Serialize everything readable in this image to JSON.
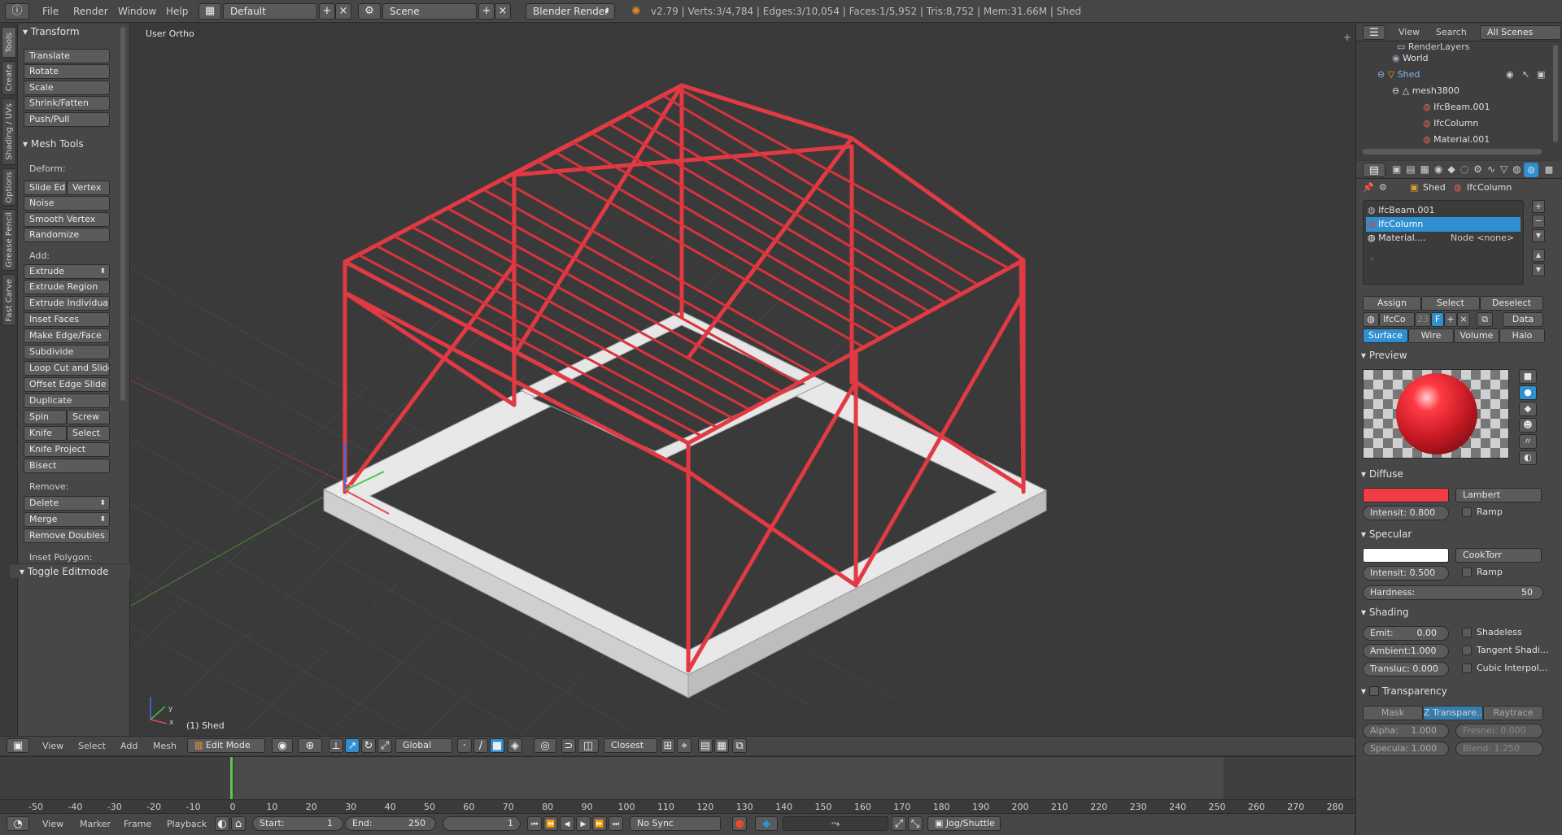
{
  "topbar": {
    "menus": [
      "File",
      "Render",
      "Window",
      "Help"
    ],
    "layout": "Default",
    "scene": "Scene",
    "engine": "Blender Render",
    "stats": "v2.79 | Verts:3/4,784 | Edges:3/10,054 | Faces:1/5,952 | Tris:8,752 | Mem:31.66M | Shed"
  },
  "vtabs": [
    "Tools",
    "Create",
    "Shading / UVs",
    "Options",
    "Grease Pencil",
    "Fast Carve"
  ],
  "toolshelf": {
    "transform_title": "Transform",
    "transform": [
      "Translate",
      "Rotate",
      "Scale",
      "Shrink/Fatten",
      "Push/Pull"
    ],
    "meshtools_title": "Mesh Tools",
    "deform_label": "Deform:",
    "slide_edge": "Slide Ed",
    "vertex": "Vertex",
    "deform": [
      "Noise",
      "Smooth Vertex",
      "Randomize"
    ],
    "add_label": "Add:",
    "add": [
      "Extrude",
      "Extrude Region",
      "Extrude Individual",
      "Inset Faces",
      "Make Edge/Face",
      "Subdivide",
      "Loop Cut and Slide",
      "Offset Edge Slide",
      "Duplicate"
    ],
    "spin": "Spin",
    "screw": "Screw",
    "knife": "Knife",
    "select": "Select",
    "add2": [
      "Knife Project",
      "Bisect"
    ],
    "remove_label": "Remove:",
    "delete": "Delete",
    "merge": "Merge",
    "remove_doubles": "Remove Doubles",
    "inset_polygon": "Inset Polygon:",
    "toggle_editmode": "Toggle Editmode"
  },
  "viewport": {
    "view_name": "User Ortho",
    "object_label": "(1) Shed",
    "axis_y": "y",
    "axis_x": "x"
  },
  "viewport_header": {
    "menus": [
      "View",
      "Select",
      "Add",
      "Mesh"
    ],
    "mode": "Edit Mode",
    "orientation": "Global",
    "snap": "Closest"
  },
  "timeline": {
    "ruler": [
      "-50",
      "-40",
      "-30",
      "-20",
      "-10",
      "0",
      "10",
      "20",
      "30",
      "40",
      "50",
      "60",
      "70",
      "80",
      "90",
      "100",
      "110",
      "120",
      "130",
      "140",
      "150",
      "160",
      "170",
      "180",
      "190",
      "200",
      "210",
      "220",
      "230",
      "240",
      "250",
      "260",
      "270",
      "280"
    ],
    "current_frame_marker": 0,
    "menus": [
      "View",
      "Marker",
      "Frame",
      "Playback"
    ],
    "start": "Start:",
    "start_val": "1",
    "end": "End:",
    "end_val": "250",
    "current": "1",
    "sync": "No Sync",
    "keying": "Jog/Shuttle"
  },
  "outliner": {
    "tabs": [
      "View",
      "Search",
      "All Scenes"
    ],
    "items": [
      {
        "label": "RenderLayers"
      },
      {
        "label": "World"
      },
      {
        "label": "Shed"
      },
      {
        "label": "mesh3800"
      },
      {
        "label": "IfcBeam.001"
      },
      {
        "label": "IfcColumn"
      },
      {
        "label": "Material.001"
      }
    ]
  },
  "properties": {
    "breadcrumb_object": "Shed",
    "breadcrumb_material": "IfcColumn",
    "slots": [
      "IfcBeam.001",
      "IfcColumn",
      "Material...."
    ],
    "slot_node": "Node <none>",
    "assign": "Assign",
    "select": "Select",
    "deselect": "Deselect",
    "mat_name": "IfcCo",
    "mat_users": "23",
    "mat_f": "F",
    "data": "Data",
    "tabs": [
      "Surface",
      "Wire",
      "Volume",
      "Halo"
    ],
    "preview_title": "Preview",
    "diffuse_title": "Diffuse",
    "diffuse_color": "#f03c44",
    "diffuse_shader": "Lambert",
    "diffuse_intensity": "Intensit: 0.800",
    "ramp": "Ramp",
    "specular_title": "Specular",
    "specular_color": "#ffffff",
    "specular_shader": "CookTorr",
    "specular_intensity": "Intensit: 0.500",
    "hardness_label": "Hardness:",
    "hardness_val": "50",
    "shading_title": "Shading",
    "emit": "Emit:",
    "emit_val": "0.00",
    "shadeless": "Shadeless",
    "ambient": "Ambient:1.000",
    "tangent": "Tangent Shadi...",
    "transluc": "Transluc: 0.000",
    "cubic": "Cubic Interpol...",
    "transparency_title": "Transparency",
    "transp_modes": [
      "Mask",
      "Z Transpare...",
      "Raytrace"
    ],
    "alpha": "Alpha:",
    "alpha_val": "1.000",
    "fresnel": "Fresnel: 0.000",
    "specula": "Specula: 1.000",
    "blend": "Blend: 1.250"
  },
  "colors": {
    "accent": "#2f8fd1",
    "steel": "#e23a42",
    "base": "#e6e6e6",
    "frame_marker": "#5ec44a"
  }
}
